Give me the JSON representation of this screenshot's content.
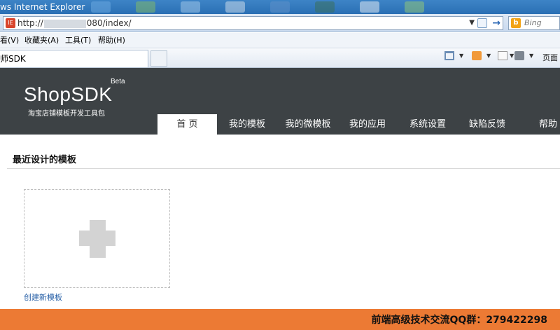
{
  "browser": {
    "title": "ws Internet Explorer",
    "url_prefix": "http://",
    "url_suffix": "080/index/",
    "search_engine": "Bing",
    "tab_title": "师SDK",
    "menu": [
      "看(V)",
      "收藏夹(A)",
      "工具(T)",
      "帮助(H)"
    ],
    "page_menu": "页面("
  },
  "site": {
    "logo": "ShopSDK",
    "beta": "Beta",
    "slogan": "淘宝店铺模板开发工具包",
    "nav": [
      {
        "label": "首 页",
        "active": true
      },
      {
        "label": "我的模板",
        "active": false
      },
      {
        "label": "我的微模板",
        "active": false
      },
      {
        "label": "我的应用",
        "active": false
      },
      {
        "label": "系统设置",
        "active": false
      },
      {
        "label": "缺陷反馈",
        "active": false
      },
      {
        "label": "帮助",
        "active": false
      }
    ]
  },
  "content": {
    "section_title": "最近设计的模板",
    "create_link": "创建新模板"
  },
  "footer": {
    "text": "前端高级技术交流QQ群：279422298"
  },
  "colors": {
    "header_bg": "#3d4245",
    "footer_bg": "#ec7a34",
    "link": "#2a62a8"
  }
}
